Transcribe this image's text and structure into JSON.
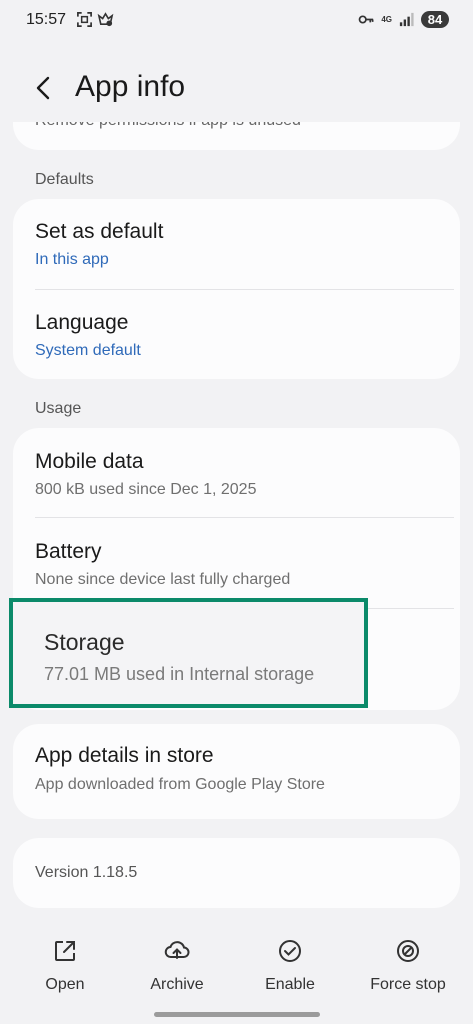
{
  "status_bar": {
    "time": "15:57",
    "network": "4G",
    "battery": "84"
  },
  "header": {
    "title": "App info"
  },
  "permissions_card": {
    "partial_text": "Remove permissions if app is unused"
  },
  "defaults": {
    "section_label": "Defaults",
    "items": [
      {
        "title": "Set as default",
        "subtitle": "In this app"
      },
      {
        "title": "Language",
        "subtitle": "System default"
      }
    ]
  },
  "usage": {
    "section_label": "Usage",
    "items": [
      {
        "title": "Mobile data",
        "subtitle": "800 kB used since Dec 1, 2025"
      },
      {
        "title": "Battery",
        "subtitle": "None since device last fully charged"
      },
      {
        "title": "Storage",
        "subtitle": "77.01 MB used in Internal storage"
      }
    ]
  },
  "store_card": {
    "title": "App details in store",
    "subtitle": "App downloaded from Google Play Store"
  },
  "version_card": {
    "text": "Version 1.18.5"
  },
  "bottom_actions": [
    {
      "label": "Open",
      "icon": "open-external-icon"
    },
    {
      "label": "Archive",
      "icon": "cloud-upload-icon"
    },
    {
      "label": "Enable",
      "icon": "check-circle-icon"
    },
    {
      "label": "Force stop",
      "icon": "block-icon"
    }
  ],
  "colors": {
    "accent_blue": "#2f6ab9",
    "highlight_green": "#0b8a6a",
    "background": "#f2f2f4",
    "card": "#fcfcfd"
  }
}
